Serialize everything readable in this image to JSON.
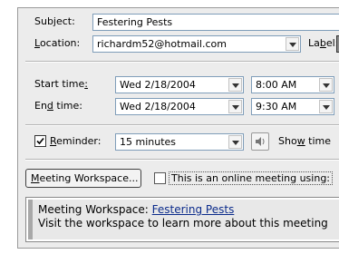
{
  "subject": {
    "label": "Subject:",
    "value": "Festering Pests"
  },
  "location": {
    "label": "Location:",
    "value": "richardm52@hotmail.com",
    "label_label": "Label:"
  },
  "start": {
    "label": "Start time:",
    "date": "Wed 2/18/2004",
    "time": "8:00 AM"
  },
  "end": {
    "label": "End time:",
    "date": "Wed 2/18/2004",
    "time": "9:30 AM"
  },
  "reminder": {
    "label": "Reminder:",
    "checked": true,
    "value": "15 minutes",
    "show_time_label": "Show time"
  },
  "workspace": {
    "button_label": "Meeting Workspace...",
    "online_label": "This is an online meeting using:",
    "online_checked": false,
    "info_prefix": "Meeting Workspace: ",
    "info_link": "Festering Pests",
    "info_text": "Visit the workspace to learn more about this meeting"
  }
}
